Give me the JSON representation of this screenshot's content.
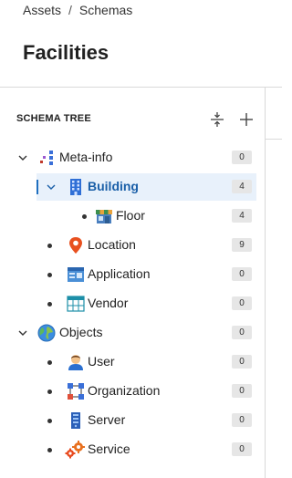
{
  "breadcrumb": {
    "items": [
      "Assets",
      "Schemas"
    ],
    "separator": "/"
  },
  "page": {
    "title": "Facilities"
  },
  "tree": {
    "header": "SCHEMA TREE",
    "nodes": [
      {
        "label": "Meta-info",
        "count": "0",
        "icon": "meta-info-icon",
        "expanded": true
      },
      {
        "label": "Building",
        "count": "4",
        "icon": "building-icon",
        "expanded": true,
        "selected": true
      },
      {
        "label": "Floor",
        "count": "4",
        "icon": "floor-icon"
      },
      {
        "label": "Location",
        "count": "9",
        "icon": "location-pin-icon"
      },
      {
        "label": "Application",
        "count": "0",
        "icon": "application-icon"
      },
      {
        "label": "Vendor",
        "count": "0",
        "icon": "vendor-icon"
      },
      {
        "label": "Objects",
        "count": "0",
        "icon": "globe-icon",
        "expanded": true
      },
      {
        "label": "User",
        "count": "0",
        "icon": "user-icon"
      },
      {
        "label": "Organization",
        "count": "0",
        "icon": "organization-icon"
      },
      {
        "label": "Server",
        "count": "0",
        "icon": "server-icon"
      },
      {
        "label": "Service",
        "count": "0",
        "icon": "service-icon"
      }
    ]
  },
  "colors": {
    "selected_background": "#e8f1fb",
    "selected_text": "#1a5fa8",
    "badge_background": "#e6e6e6"
  }
}
